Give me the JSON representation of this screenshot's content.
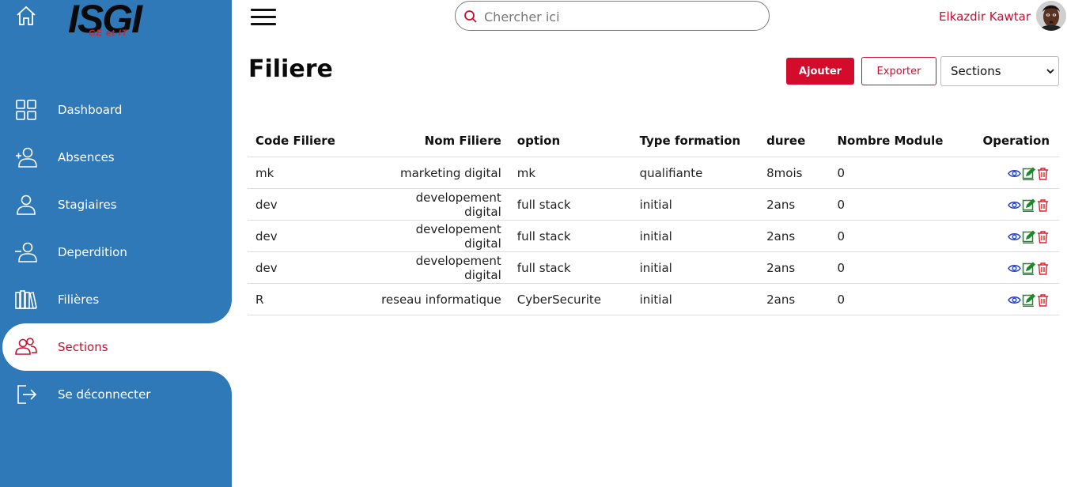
{
  "sidebar": {
    "logo_text": "ISGI",
    "logo_sub": "GE et IT",
    "items": [
      {
        "label": "Dashboard",
        "icon": "grid-icon"
      },
      {
        "label": "Absences",
        "icon": "user-plus-icon"
      },
      {
        "label": "Stagiaires",
        "icon": "user-icon"
      },
      {
        "label": "Deperdition",
        "icon": "user-minus-icon"
      },
      {
        "label": "Filières",
        "icon": "books-icon"
      },
      {
        "label": "Sections",
        "icon": "users-icon",
        "active": true
      },
      {
        "label": "Se déconnecter",
        "icon": "logout-icon"
      }
    ]
  },
  "header": {
    "search_placeholder": "Chercher ici",
    "user_name": "Elkazdir Kawtar"
  },
  "main": {
    "title": "Filiere",
    "add_label": "Ajouter",
    "export_label": "Exporter",
    "select_value": "Sections"
  },
  "table": {
    "columns": [
      "Code Filiere",
      "Nom Filiere",
      "option",
      "Type formation",
      "duree",
      "Nombre Module",
      "Operation"
    ],
    "rows": [
      [
        "mk",
        "marketing digital",
        "mk",
        "qualifiante",
        "8mois",
        "0"
      ],
      [
        "dev",
        "developement digital",
        "full stack",
        "initial",
        "2ans",
        "0"
      ],
      [
        "dev",
        "developement digital",
        "full stack",
        "initial",
        "2ans",
        "0"
      ],
      [
        "dev",
        "developement digital",
        "full stack",
        "initial",
        "2ans",
        "0"
      ],
      [
        "R",
        "reseau informatique",
        "CyberSecurite",
        "initial",
        "2ans",
        "0"
      ]
    ]
  },
  "colors": {
    "sidebar": "#2f79b8",
    "accent": "#c8102e",
    "add_button": "#d50b2c",
    "view_icon": "#1f3fd1",
    "edit_icon": "#1a8a2a",
    "delete_icon": "#d8262e"
  }
}
